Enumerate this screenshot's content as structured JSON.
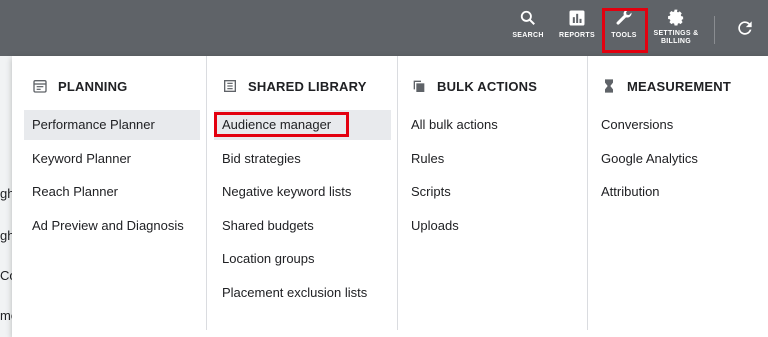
{
  "topbar": {
    "search_label": "SEARCH",
    "reports_label": "REPORTS",
    "tools_label": "TOOLS",
    "settings_label_line1": "SETTINGS &",
    "settings_label_line2": "BILLING"
  },
  "backdrop": [
    "gh",
    "gh",
    "Co",
    "mo"
  ],
  "columns": [
    {
      "heading": "PLANNING",
      "icon": "calendar-icon",
      "items": [
        "Performance Planner",
        "Keyword Planner",
        "Reach Planner",
        "Ad Preview and Diagnosis"
      ]
    },
    {
      "heading": "SHARED LIBRARY",
      "icon": "library-icon",
      "items": [
        "Audience manager",
        "Bid strategies",
        "Negative keyword lists",
        "Shared budgets",
        "Location groups",
        "Placement exclusion lists"
      ]
    },
    {
      "heading": "BULK ACTIONS",
      "icon": "copy-icon",
      "items": [
        "All bulk actions",
        "Rules",
        "Scripts",
        "Uploads"
      ]
    },
    {
      "heading": "MEASUREMENT",
      "icon": "hourglass-icon",
      "items": [
        "Conversions",
        "Google Analytics",
        "Attribution"
      ]
    }
  ],
  "colors": {
    "topbar": "#5f6368",
    "highlight": "#e3000f",
    "active_row": "#e8eaed"
  }
}
